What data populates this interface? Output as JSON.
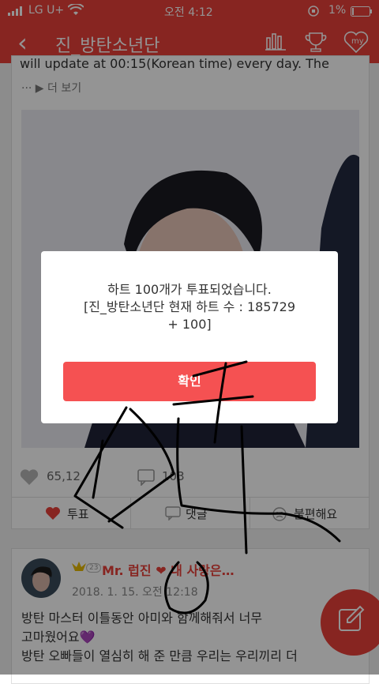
{
  "status": {
    "carrier": "LG U+",
    "time": "오전 4:12",
    "battery": "1%"
  },
  "header": {
    "title": "진_방탄소년단",
    "icons": [
      "back-chevron-icon",
      "bar-chart-icon",
      "trophy-icon",
      "my-heart-icon"
    ],
    "my_label": "my"
  },
  "post": {
    "text_fragment": "will update at 00:15(Korean time) every day. The",
    "more": "··· ▶ 더 보기",
    "likes": "65,12",
    "comments": "103",
    "actions": {
      "vote": "투표",
      "comment": "댓글",
      "dislike": "불편해요"
    }
  },
  "comment": {
    "level": "23",
    "username": "Mr. 럽진 ❤ 내 사랑은…",
    "date": "2018. 1. 15. 오전 12:18",
    "line1": "방탄 마스터 이틀동안 아미와 함께해줘서 너무",
    "line2": "고마웠어요💜",
    "line3": "방탄 오빠들이 열심히 해 준 만큼 우리는 우리끼리 더"
  },
  "dialog": {
    "line1": "하트 100개가 투표되었습니다.",
    "line2": "[진_방탄소년단 현재 하트 수 : 185729",
    "line3": "+ 100]",
    "confirm": "확인"
  },
  "colors": {
    "brand": "#e8413a",
    "button": "#f55152",
    "dim": "rgba(0,0,0,0.42)"
  }
}
